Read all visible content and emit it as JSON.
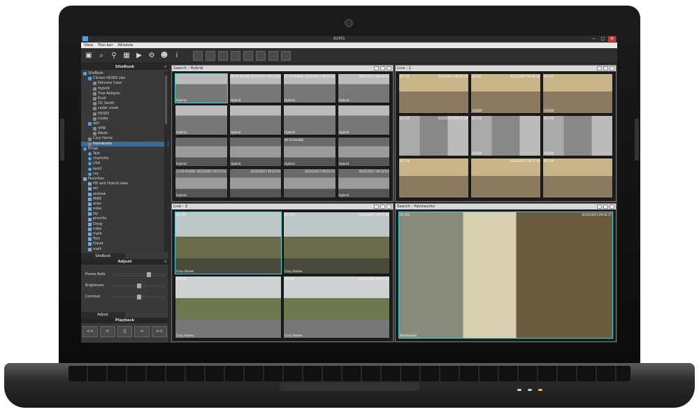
{
  "window": {
    "title": "AVMS",
    "controls": [
      "—",
      "□",
      "✕"
    ]
  },
  "menu": [
    "View",
    "Tool bar",
    "Window"
  ],
  "toolbar_icons": [
    "camera-list-icon",
    "search-icon",
    "map-pin-icon",
    "record-icon",
    "playback-icon",
    "settings-icon",
    "users-icon",
    "info-icon",
    "layout-1-icon",
    "layout-4-icon",
    "layout-9-icon",
    "layout-16-icon",
    "layout-6-icon",
    "layout-8-icon",
    "layout-10-icon",
    "layout-13-icon"
  ],
  "sitebook": {
    "heading": "SiteBook",
    "items": [
      {
        "label": "SiteBook",
        "icon": "folder",
        "indent": 0
      },
      {
        "label": "Clinton HDSDI site",
        "icon": "folder",
        "indent": 1
      },
      {
        "label": "Pelicans Case",
        "icon": "cam",
        "indent": 2
      },
      {
        "label": "Hybrid",
        "icon": "cam",
        "indent": 2
      },
      {
        "label": "True Religion",
        "icon": "cam",
        "indent": 2
      },
      {
        "label": "Ecoli",
        "icon": "cam",
        "indent": 2
      },
      {
        "label": "DC South",
        "icon": "cam",
        "indent": 2
      },
      {
        "label": "cedar creek",
        "icon": "cam",
        "indent": 2
      },
      {
        "label": "HDSDI",
        "icon": "cam",
        "indent": 2
      },
      {
        "label": "Cedar",
        "icon": "cam",
        "indent": 2
      },
      {
        "label": "dell",
        "icon": "folder",
        "indent": 1
      },
      {
        "label": "VPW",
        "icon": "cam",
        "indent": 2
      },
      {
        "label": "Wade",
        "icon": "cam",
        "indent": 2
      },
      {
        "label": "Cory Home",
        "icon": "cam",
        "indent": 1
      },
      {
        "label": "Paintworks",
        "icon": "cam",
        "indent": 1,
        "selected": true
      },
      {
        "label": "Emap",
        "icon": "globe",
        "indent": 0
      },
      {
        "label": "Test",
        "icon": "globe",
        "indent": 1
      },
      {
        "label": "charlotte",
        "icon": "globe",
        "indent": 1
      },
      {
        "label": "USA",
        "icon": "globe",
        "indent": 1
      },
      {
        "label": "test2",
        "icon": "globe",
        "indent": 1
      },
      {
        "label": "ray",
        "icon": "globe",
        "indent": 1
      },
      {
        "label": "Favorites",
        "icon": "star",
        "indent": 0
      },
      {
        "label": "HD and Hybrid view",
        "icon": "star",
        "indent": 1
      },
      {
        "label": "wil",
        "icon": "star",
        "indent": 1
      },
      {
        "label": "andrew",
        "icon": "star",
        "indent": 1
      },
      {
        "label": "MIKE",
        "icon": "star",
        "indent": 1
      },
      {
        "label": "allan",
        "icon": "star",
        "indent": 1
      },
      {
        "label": "mike",
        "icon": "star",
        "indent": 1
      },
      {
        "label": "Jay",
        "icon": "star",
        "indent": 1
      },
      {
        "label": "priscilla",
        "icon": "star",
        "indent": 1
      },
      {
        "label": "Doug",
        "icon": "star",
        "indent": 1
      },
      {
        "label": "mike",
        "icon": "star",
        "indent": 1
      },
      {
        "label": "mark",
        "icon": "star",
        "indent": 1
      },
      {
        "label": "Tom",
        "icon": "star",
        "indent": 1
      },
      {
        "label": "David",
        "icon": "star",
        "indent": 1
      },
      {
        "label": "matt",
        "icon": "star",
        "indent": 1
      }
    ],
    "tab_label": "SiteBook"
  },
  "adjust": {
    "heading": "Adjust",
    "rows": [
      {
        "label": "Frame Rate",
        "level": 0.7
      },
      {
        "label": "Brightness",
        "level": 0.5
      },
      {
        "label": "Contrast",
        "level": 0.5
      }
    ],
    "tab_label": "Adjust"
  },
  "playback": {
    "heading": "Playback",
    "buttons": [
      "<<",
      "<",
      "||",
      ">",
      ">>"
    ]
  },
  "panes": {
    "hybrid": {
      "title": "Search - Hybrid",
      "tiles": [
        {
          "id": "",
          "ts": "",
          "label": "Hybrid",
          "kind": "t-lot",
          "selected": true
        },
        {
          "id": "06 CE-XV4HD",
          "ts": "02/22/2017 09:23:54",
          "label": "Hybrid",
          "kind": "t-lot"
        },
        {
          "id": "07 CE-XV4HD",
          "ts": "02/22/2017 09:23:54",
          "label": "Hybrid",
          "kind": "t-lot"
        },
        {
          "id": "",
          "ts": "02/22/2017 09:23:54",
          "label": "Hybrid",
          "kind": "t-lot"
        },
        {
          "id": "",
          "ts": "",
          "label": "Hybrid",
          "kind": "t-lot"
        },
        {
          "id": "",
          "ts": "",
          "label": "Hybrid",
          "kind": "t-lot"
        },
        {
          "id": "",
          "ts": "",
          "label": "Hybrid",
          "kind": "t-lot"
        },
        {
          "id": "",
          "ts": "",
          "label": "Hybrid",
          "kind": "t-lot"
        },
        {
          "id": "",
          "ts": "",
          "label": "Hybrid",
          "kind": "t-ware"
        },
        {
          "id": "",
          "ts": "",
          "label": "Hybrid",
          "kind": "t-ware"
        },
        {
          "id": "09 CE-XV4HD",
          "ts": "",
          "label": "Hybrid",
          "kind": "t-ware"
        },
        {
          "id": "",
          "ts": "",
          "label": "Hybrid",
          "kind": "t-ware"
        },
        {
          "id": "13 CE-XV4HD",
          "ts": "02/22/2017 09:23:54",
          "label": "Hybrid",
          "kind": "t-ware"
        },
        {
          "id": "",
          "ts": "02/22/2017 09:23:54",
          "label": "",
          "kind": "t-ware"
        },
        {
          "id": "",
          "ts": "02/22/2017 09:23:54",
          "label": "",
          "kind": "t-ware"
        },
        {
          "id": "",
          "ts": "02/22/2017 09:23:54",
          "label": "Hybrid",
          "kind": "t-ware"
        }
      ]
    },
    "live1": {
      "title": "Live - 1",
      "tiles": [
        {
          "id": "01 C01",
          "ts": "02/22/2017 09:35:18",
          "label": "",
          "kind": "t-office"
        },
        {
          "id": "02 C01",
          "ts": "02/22/2017 09:35:18",
          "label": "HDSDI",
          "kind": "t-office"
        },
        {
          "id": "03 C01",
          "ts": "",
          "label": "HDSDI",
          "kind": "t-office"
        },
        {
          "id": "04 C05",
          "ts": "02/22/2017 09:35:18",
          "label": "",
          "kind": "t-hall"
        },
        {
          "id": "05 C06",
          "ts": "",
          "label": "HDSDI",
          "kind": "t-hall"
        },
        {
          "id": "06 C08",
          "ts": "",
          "label": "HDSDI",
          "kind": "t-hall"
        },
        {
          "id": "07 C09",
          "ts": "",
          "label": "",
          "kind": "t-office"
        },
        {
          "id": "",
          "ts": "02/22/2017 09:35:18",
          "label": "",
          "kind": "t-office"
        },
        {
          "id": "09 C09",
          "ts": "",
          "label": "",
          "kind": "t-office"
        }
      ]
    },
    "live2": {
      "title": "Live - 2",
      "tiles": [
        {
          "id": "01 C01",
          "ts": "",
          "label": "Cory Home",
          "kind": "t-yard",
          "selected": true
        },
        {
          "id": "02 C02",
          "ts": "02/22/2017 09:23:50",
          "label": "Cory Home",
          "kind": "t-yard"
        },
        {
          "id": "03 C03",
          "ts": "",
          "label": "Cory Home",
          "kind": "t-street"
        },
        {
          "id": "04 C04",
          "ts": "02/22/2017 09:23:51",
          "label": "Cory Home",
          "kind": "t-street"
        }
      ]
    },
    "paintworks": {
      "title": "Search - Paintworks",
      "tiles": [
        {
          "id": "01 C01",
          "ts": "02/22/2017 09:35:17",
          "label": "Paintworks",
          "kind": "t-shop",
          "selected": true
        }
      ]
    }
  }
}
